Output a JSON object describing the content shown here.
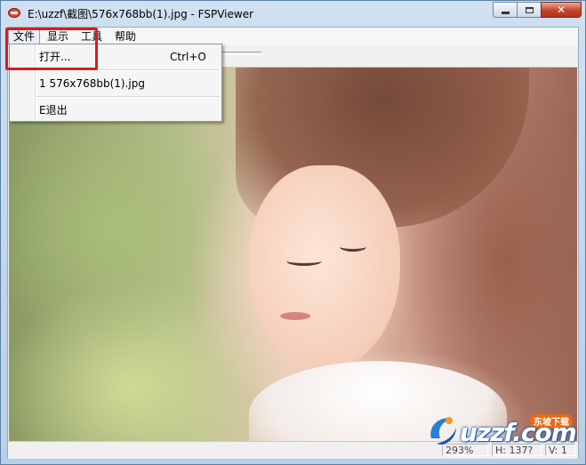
{
  "window": {
    "title": "E:\\uzzf\\截图\\576x768bb(1).jpg - FSPViewer",
    "app_icon": "fspviewer-app-icon",
    "buttons": {
      "minimize": "minimize-icon",
      "maximize": "maximize-icon",
      "close": "✕"
    }
  },
  "menubar": {
    "items": [
      {
        "label": "文件"
      },
      {
        "label": "显示"
      },
      {
        "label": "工具"
      },
      {
        "label": "帮助"
      }
    ]
  },
  "file_menu": {
    "items": [
      {
        "label": "打开...",
        "shortcut": "Ctrl+O"
      },
      {
        "label": "1 576x768bb(1).jpg",
        "shortcut": ""
      },
      {
        "label": "E退出",
        "shortcut": ""
      }
    ]
  },
  "statusbar": {
    "zoom": "293%",
    "height": "H: 137?",
    "v": "V: 1"
  },
  "watermark": {
    "text": "uzzf.com",
    "tag": "东坡下载"
  },
  "colors": {
    "highlight_box": "#e01a1a",
    "title_bar": "#cfe0f1",
    "close_button": "#c7432c"
  }
}
